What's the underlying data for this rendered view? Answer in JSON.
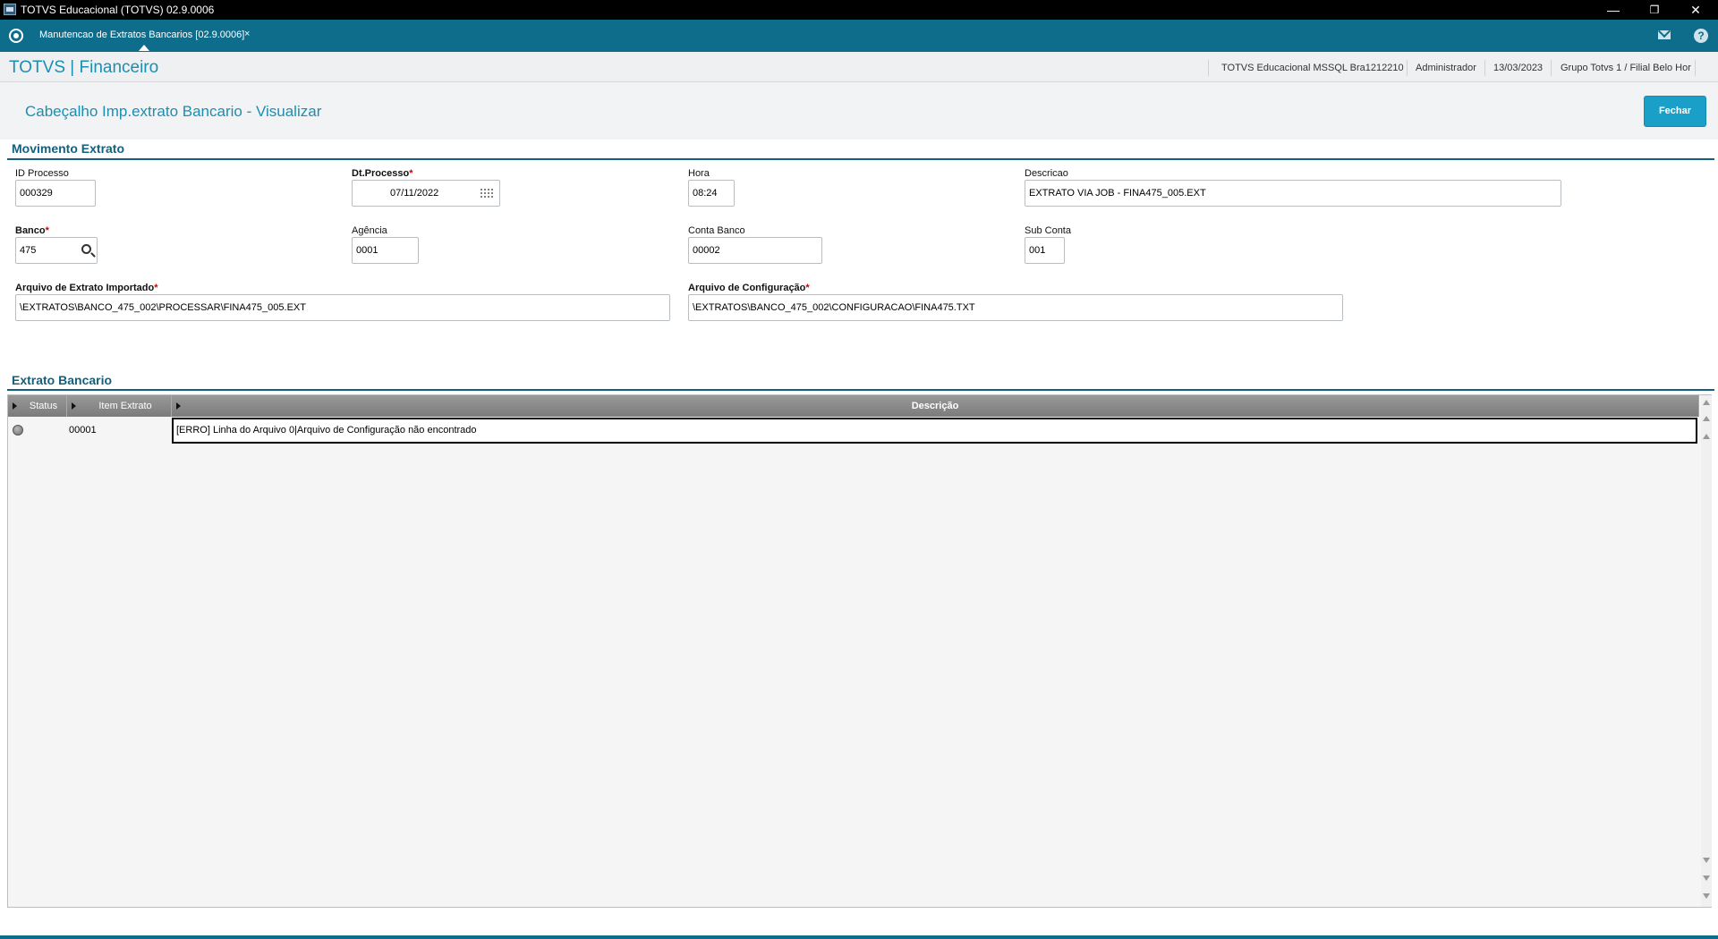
{
  "window": {
    "title": "TOTVS Educacional (TOTVS) 02.9.0006",
    "controls": {
      "minimize": "—",
      "restore": "❐",
      "close": "✕"
    }
  },
  "tabbar": {
    "tab_label": "Manutencao de Extratos Bancarios [02.9.0006]",
    "tab_close": "×"
  },
  "module_header": {
    "module_name": "TOTVS | Financeiro",
    "environment": "TOTVS Educacional MSSQL Bra1212210",
    "user": "Administrador",
    "date": "13/03/2023",
    "branch": "Grupo Totvs 1 / Filial Belo Hor"
  },
  "page": {
    "title": "Cabeçalho Imp.extrato Bancario - Visualizar",
    "close_button": "Fechar"
  },
  "movimento": {
    "section_title": "Movimento Extrato",
    "fields": {
      "id_processo": {
        "label": "ID Processo",
        "value": "000329"
      },
      "dt_processo": {
        "label": "Dt.Processo",
        "value": "07/11/2022"
      },
      "hora": {
        "label": "Hora",
        "value": "08:24"
      },
      "descricao": {
        "label": "Descricao",
        "value": "EXTRATO VIA JOB - FINA475_005.EXT"
      },
      "banco": {
        "label": "Banco",
        "value": "475"
      },
      "agencia": {
        "label": "Agência",
        "value": "0001"
      },
      "conta_banco": {
        "label": "Conta Banco",
        "value": "00002"
      },
      "sub_conta": {
        "label": "Sub Conta",
        "value": "001"
      },
      "arquivo_extrato": {
        "label": "Arquivo de Extrato Importado",
        "value": "\\EXTRATOS\\BANCO_475_002\\PROCESSAR\\FINA475_005.EXT"
      },
      "arquivo_config": {
        "label": "Arquivo de Configuração",
        "value": "\\EXTRATOS\\BANCO_475_002\\CONFIGURACAO\\FINA475.TXT"
      }
    },
    "required_marker": "*"
  },
  "extrato": {
    "section_title": "Extrato Bancario",
    "columns": [
      "Status",
      "Item Extrato",
      "Descrição"
    ],
    "rows": [
      {
        "status": "gray",
        "item": "00001",
        "descricao": "[ERRO] Linha do Arquivo 0|Arquivo de Configuração não encontrado"
      }
    ]
  },
  "colors": {
    "tabbar": "#0f6d8c",
    "accent": "#1b8fb2",
    "button": "#1aa0c8",
    "section": "#12607e",
    "required": "#d40000"
  }
}
